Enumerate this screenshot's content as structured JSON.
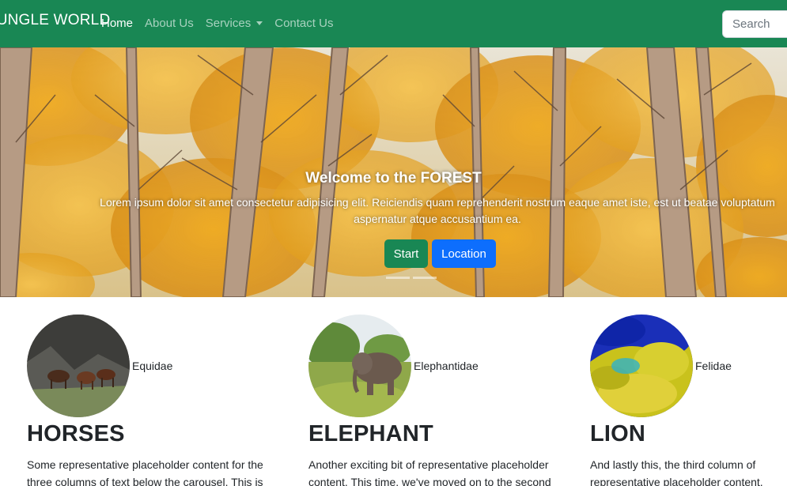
{
  "nav": {
    "brand": "JUNGLE WORLD",
    "links": [
      "Home",
      "About Us",
      "Services",
      "Contact Us"
    ],
    "search_placeholder": "Search"
  },
  "hero": {
    "title": "Welcome to the FOREST",
    "text": "Lorem ipsum dolor sit amet consectetur adipisicing elit. Reiciendis quam reprehenderit nostrum eaque amet iste, est ut beatae voluptatum aspernatur atque accusantium ea.",
    "buttons": [
      "Start",
      "Location"
    ]
  },
  "columns": [
    {
      "family": "Equidae",
      "heading": "HORSES",
      "text": "Some representative placeholder content for the three columns of text below the carousel. This is"
    },
    {
      "family": "Elephantidae",
      "heading": "ELEPHANT",
      "text": "Another exciting bit of representative placeholder content. This time, we've moved on to the second"
    },
    {
      "family": "Felidae",
      "heading": "LION",
      "text": "And lastly this, the third column of representative placeholder content."
    }
  ],
  "colors": {
    "navbar": "#198754",
    "start_button": "#198754",
    "location_button": "#0d6efd"
  }
}
